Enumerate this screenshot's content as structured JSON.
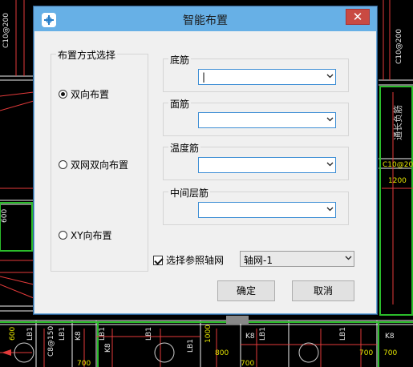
{
  "background": {
    "drawing_labels": [
      "C10@200",
      "C10@200",
      "通长负筋",
      "C10@200",
      "1200",
      "C8@150",
      "LB1",
      "LB1",
      "K8",
      "LB1",
      "LB1",
      "K8",
      "LB1",
      "K8",
      "LB1",
      "LB1",
      "K8",
      "700",
      "800",
      "700",
      "700",
      "700",
      "1000",
      "600",
      "600"
    ]
  },
  "dialog": {
    "title": "智能布置",
    "close_glyph": "✕",
    "layout_group": {
      "label": "布置方式选择",
      "options": [
        {
          "label": "双向布置",
          "selected": true
        },
        {
          "label": "双网双向布置",
          "selected": false
        },
        {
          "label": "XY向布置",
          "selected": false
        }
      ]
    },
    "bar_groups": [
      {
        "label": "底筋",
        "value": "|"
      },
      {
        "label": "面筋",
        "value": ""
      },
      {
        "label": "温度筋",
        "value": ""
      },
      {
        "label": "中间层筋",
        "value": ""
      }
    ],
    "reference": {
      "checkbox_label": "选择参照轴网",
      "checked": true,
      "selected": "轴网-1"
    },
    "ok_label": "确定",
    "cancel_label": "取消"
  },
  "colors": {
    "titlebar": "#67b0e6",
    "cad_line_red": "#e33a3a",
    "cad_line_white": "#f2f2f2",
    "cad_line_green": "#2bbd2b"
  }
}
